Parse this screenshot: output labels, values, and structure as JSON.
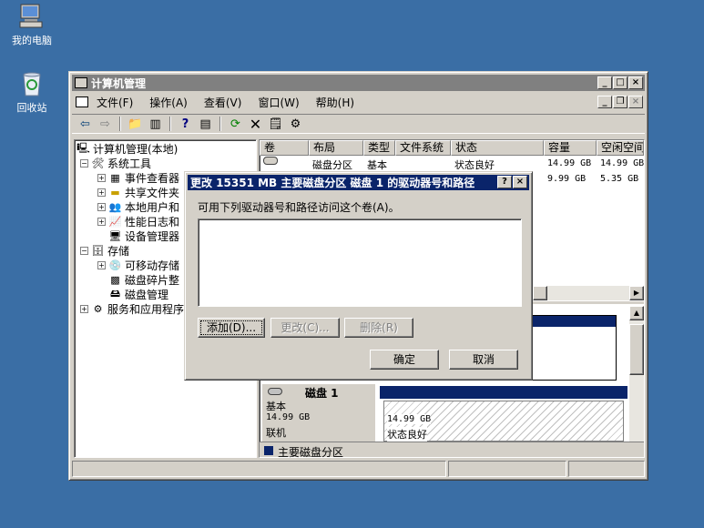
{
  "desktop": {
    "icons": [
      {
        "label": "我的电脑",
        "icon": "my-computer-icon"
      },
      {
        "label": "回收站",
        "icon": "recycle-bin-icon"
      }
    ]
  },
  "window": {
    "title": "计算机管理",
    "menu": [
      "文件(F)",
      "操作(A)",
      "查看(V)",
      "窗口(W)",
      "帮助(H)"
    ],
    "toolbar_icons": [
      "back-icon",
      "forward-icon",
      "up-icon",
      "show-tree-icon",
      "help-icon",
      "properties-view-icon",
      "refresh-icon",
      "delete-icon",
      "properties-icon",
      "settings-icon"
    ]
  },
  "tree": {
    "root": "计算机管理(本地)",
    "system_tools": "系统工具",
    "event_viewer": "事件查看器",
    "shared_folders": "共享文件夹",
    "local_users": "本地用户和",
    "perf_logs": "性能日志和",
    "device_manager": "设备管理器",
    "storage": "存储",
    "removable": "可移动存储",
    "defrag": "磁盘碎片整",
    "disk_mgmt": "磁盘管理",
    "services": "服务和应用程序"
  },
  "volumes": {
    "headers": [
      "卷",
      "布局",
      "类型",
      "文件系统",
      "状态",
      "容量",
      "空闲空间"
    ],
    "rows": [
      {
        "vol": "",
        "layout": "磁盘分区",
        "type": "基本",
        "fs": "",
        "status": "状态良好",
        "cap": "14.99 GB",
        "free": "14.99 GB"
      },
      {
        "vol": "",
        "layout": "",
        "type": "",
        "fs": "",
        "status": "",
        "cap": "9.99 GB",
        "free": "5.35 GB"
      }
    ]
  },
  "disk": {
    "name": "磁盘 1",
    "kind": "基本",
    "size": "14.99 GB",
    "state": "联机",
    "part_size": "14.99 GB",
    "part_status": "状态良好",
    "legend": "主要磁盘分区"
  },
  "dialog": {
    "title": "更改 15351 MB  主要磁盘分区  磁盘 1 的驱动器号和路径",
    "description": "可用下列驱动器号和路径访问这个卷(A)。",
    "add": "添加(D)...",
    "change": "更改(C)...",
    "remove": "删除(R)",
    "ok": "确定",
    "cancel": "取消"
  }
}
